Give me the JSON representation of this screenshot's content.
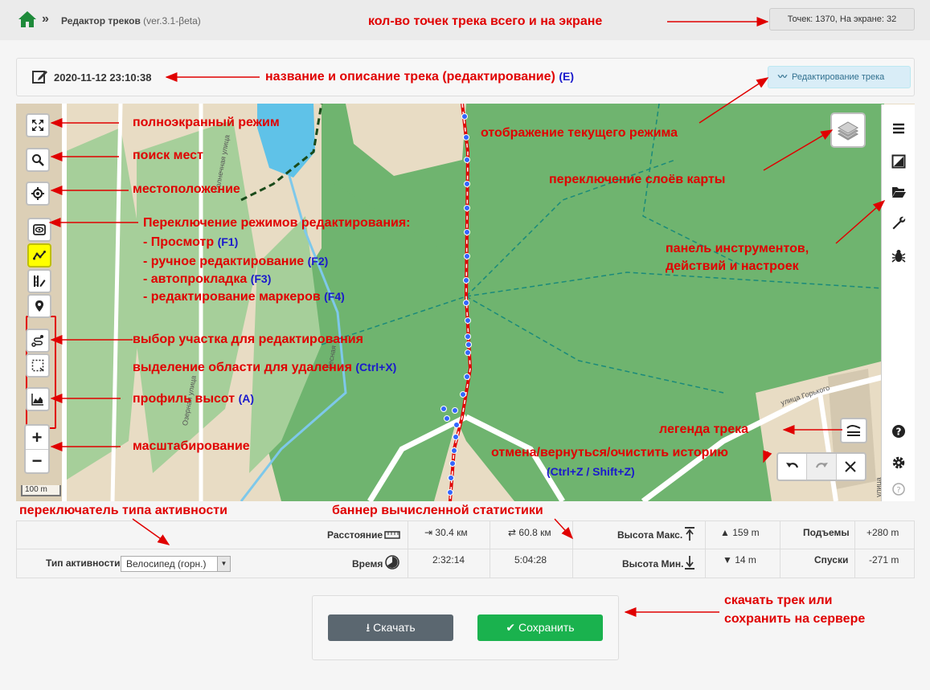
{
  "header": {
    "app_title": "Редактор треков",
    "version": "(ver.3.1-βeta)",
    "points_counter": "Точек: 1370, На экране: 32"
  },
  "track": {
    "title": "2020-11-12 23:10:38",
    "mode_badge": "Редактирование трека"
  },
  "map": {
    "scale_label": "100 m",
    "zoom_in": "+",
    "zoom_out": "−",
    "street_labels": [
      "Озерная улица",
      "Солнечная улица",
      "улица Горького",
      "улица",
      "Лесная"
    ],
    "icons": {
      "controls": [
        "fullscreen-icon",
        "search-icon",
        "locate-icon",
        "eye-icon",
        "track-draw-icon",
        "auto-route-icon",
        "marker-icon",
        "segment-select-icon",
        "area-select-icon",
        "elevation-profile-icon"
      ],
      "tools": [
        "menu-icon",
        "image-icon",
        "folder-open-icon",
        "wrench-icon",
        "bug-icon",
        "help-icon",
        "gear-icon"
      ],
      "history": [
        "undo-icon",
        "redo-icon",
        "clear-icon"
      ]
    }
  },
  "stats": {
    "distance_label": "Расстояние",
    "distance_one": "30.4 км",
    "distance_total": "60.8 км",
    "time_label": "Время",
    "time_one": "2:32:14",
    "time_total": "5:04:28",
    "elev_max_label": "Высота Макс.",
    "elev_max": "159 m",
    "elev_min_label": "Высота Мин.",
    "elev_min": "14 m",
    "ascents_label": "Подъемы",
    "ascents": "+280 m",
    "descents_label": "Спуски",
    "descents": "-271 m",
    "activity_label": "Тип активности:",
    "activity_value": "Велосипед (горн.)"
  },
  "actions": {
    "download": "Скачать",
    "save": "Сохранить"
  },
  "annotations": {
    "points": "кол-во точек трека всего и на экране",
    "title": "название и описание трека (редактирование)",
    "title_key": "(E)",
    "fullscreen": "полноэкранный режим",
    "search": "поиск мест",
    "location": "местоположение",
    "modes_header": "Переключение режимов редактирования:",
    "mode_view": "- Просмотр",
    "mode_view_key": "(F1)",
    "mode_manual": "- ручное редактирование",
    "mode_manual_key": "(F2)",
    "mode_auto": "- автопрокладка",
    "mode_auto_key": "(F3)",
    "mode_markers": "- редактирование маркеров",
    "mode_markers_key": "(F4)",
    "segment": "выбор участка для редактирования",
    "area_delete": "выделение области для удаления",
    "area_delete_key": "(Ctrl+X)",
    "profile": "профиль высот",
    "profile_key": "(A)",
    "zoom": "масштабирование",
    "current_mode": "отображение текущего режима",
    "layers": "переключение слоёв карты",
    "tools_line1": "панель инструментов,",
    "tools_line2": "действий и настроек",
    "legend": "легенда трека",
    "history": "отмена/вернуться/очистить историю",
    "history_keys": "(Ctrl+Z / Shift+Z)",
    "activity_switch": "переключатель типа активности",
    "stats_banner": "баннер вычисленной статистики",
    "download_line1": "скачать трек или",
    "download_line2": "сохранить на сервере"
  },
  "colors": {
    "annotation": "#e00000",
    "hotkey": "#1a1acc",
    "forest": "#6fb46f",
    "track_red": "#e00000",
    "track_point": "#3366ff",
    "save_green": "#1ab24e",
    "download_gray": "#5b6770"
  }
}
